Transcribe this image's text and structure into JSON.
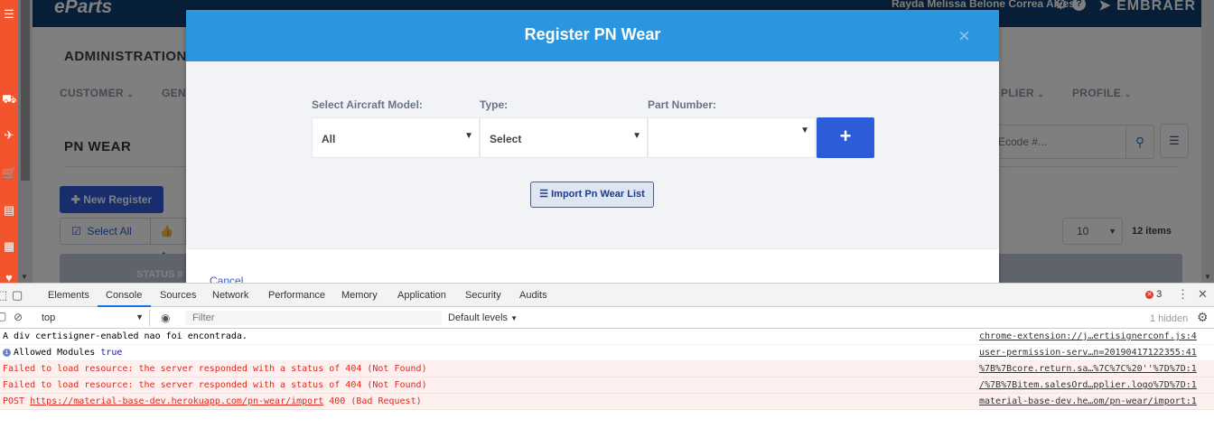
{
  "sidebar": {
    "icons": [
      "menu-icon",
      "truck-icon",
      "airplane-icon",
      "cart-icon",
      "document-icon",
      "calendar-icon",
      "heart-icon"
    ]
  },
  "topbar": {
    "brand": "eParts",
    "user_name": "Rayda Melissa Belone Correa Alves",
    "company": "EMBRAER"
  },
  "header": {
    "title": "ADMINISTRATION",
    "nav": [
      "CUSTOMER",
      "GEN",
      "PLIER",
      "PROFILE"
    ]
  },
  "page": {
    "title": "PN WEAR",
    "search_placeholder": "Ecode #...",
    "new_register": "New Register",
    "select_all": "Select All",
    "approve_partial": "Ap",
    "page_size": "10",
    "items_count": "12 items",
    "status_header": "STATUS #"
  },
  "modal": {
    "title": "Register PN Wear",
    "close": "×",
    "labels": {
      "aircraft": "Select Aircraft Model:",
      "type": "Type:",
      "part_number": "Part Number:"
    },
    "values": {
      "aircraft": "All",
      "type": "Select",
      "part_number": ""
    },
    "add": "+",
    "import": "Import Pn Wear List",
    "cancel": "Cancel"
  },
  "devtools": {
    "tabs": [
      "Elements",
      "Console",
      "Sources",
      "Network",
      "Performance",
      "Memory",
      "Application",
      "Security",
      "Audits"
    ],
    "active_tab": "Console",
    "error_count": "3",
    "context": "top",
    "filter_placeholder": "Filter",
    "levels": "Default levels",
    "hidden": "1 hidden",
    "logs": [
      {
        "type": "log",
        "text": "A div certisigner-enabled nao foi encontrada.",
        "source": "chrome-extension://j…ertisignerconf.js:4"
      },
      {
        "type": "info",
        "text": "Allowed Modules",
        "value": "true",
        "source": "user-permission-serv…n=20190417122355:41"
      },
      {
        "type": "error",
        "text": "Failed to load resource: the server responded with a status of 404 (Not Found)",
        "source": "%7B%7Bcore.return.sa…%7C%7C%20''%7D%7D:1"
      },
      {
        "type": "error",
        "text": "Failed to load resource: the server responded with a status of 404 (Not Found)",
        "source": "/%7B%7Bitem.salesOrd…pplier.logo%7D%7D:1"
      },
      {
        "type": "error",
        "prefix": "POST",
        "url": "https://material-base-dev.herokuapp.com/pn-wear/import",
        "suffix": "400 (Bad Request)",
        "source": "material-base-dev.he…om/pn-wear/import:1"
      }
    ]
  }
}
